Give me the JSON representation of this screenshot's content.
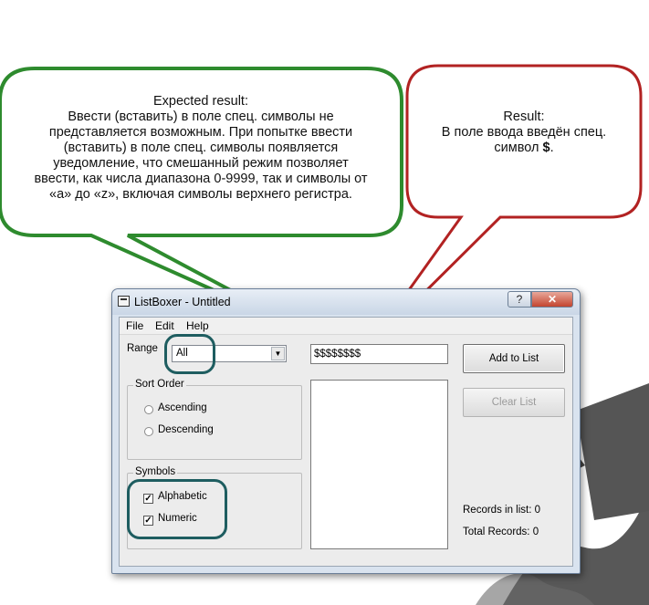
{
  "callouts": {
    "expected": {
      "title": "Expected result:",
      "lines": [
        "Ввести (вставить) в поле спец. символы не",
        "представляется возможным. При попытке ввести",
        "(вставить) в поле спец. символы  появляется",
        "уведомление, что смешанный режим позволяет",
        "ввести, как числа диапазона 0-9999, так и символы от",
        "«a» до «z», включая символы верхнего регистра."
      ]
    },
    "result": {
      "title": "Result:",
      "line1": "В поле ввода введён спец.",
      "line2_prefix": "символ ",
      "line2_symbol": "$",
      "line2_suffix": "."
    }
  },
  "window": {
    "title": "ListBoxer - Untitled",
    "help_btn": "?",
    "close_btn": "✕",
    "menu": [
      "File",
      "Edit",
      "Help"
    ],
    "range_label": "Range",
    "range_value": "All",
    "sort_order": {
      "title": "Sort Order",
      "options": [
        "Ascending",
        "Descending"
      ]
    },
    "symbols": {
      "title": "Symbols",
      "options": [
        {
          "label": "Alphabetic",
          "checked": true
        },
        {
          "label": "Numeric",
          "checked": true
        }
      ]
    },
    "input_value": "$$$$$$$$",
    "add_button": "Add to List",
    "clear_button": "Clear List",
    "records_in_list": "Records in list: 0",
    "total_records": "Total Records: 0"
  },
  "colors": {
    "green_callout": "#2e8b2e",
    "red_callout": "#b22222",
    "highlight": "#1e5d60"
  }
}
